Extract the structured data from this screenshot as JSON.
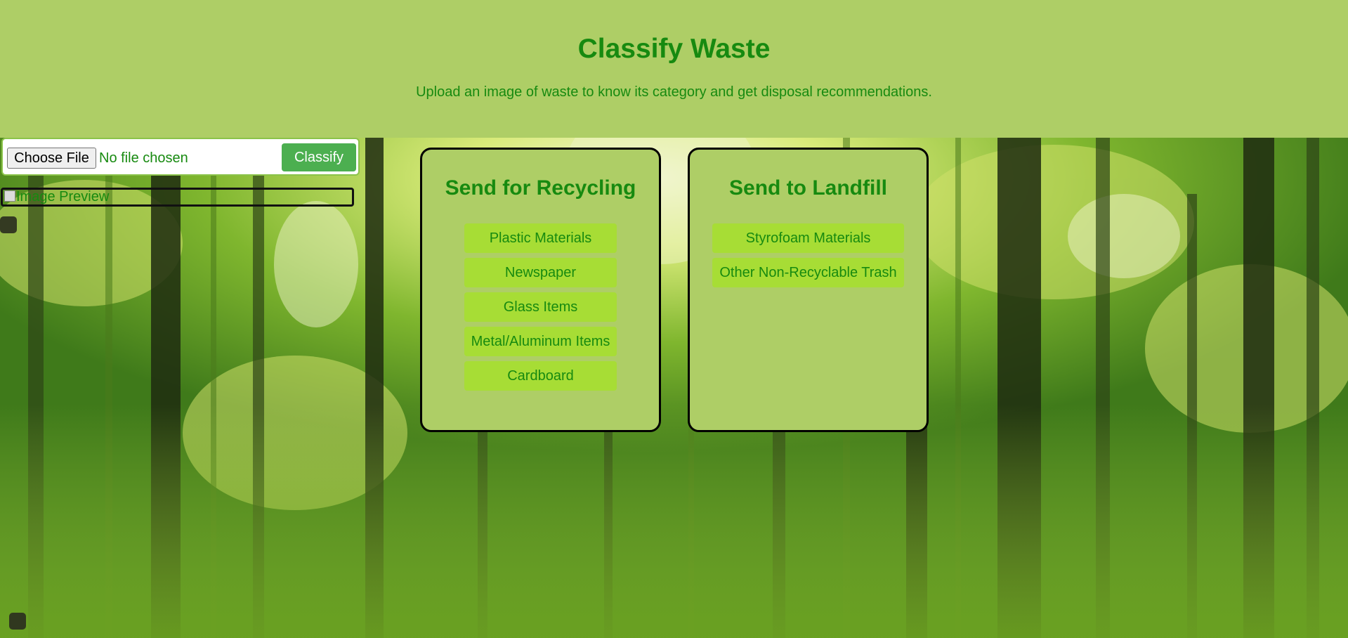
{
  "header": {
    "title": "Classify Waste",
    "subtitle": "Upload an image of waste to know its category and get disposal recommendations."
  },
  "upload": {
    "choose_label": "Choose File",
    "file_status": "No file chosen",
    "classify_label": "Classify"
  },
  "preview": {
    "alt_text": "Image Preview"
  },
  "recycling": {
    "title": "Send for Recycling",
    "items": [
      {
        "label": "Plastic Materials"
      },
      {
        "label": "Newspaper"
      },
      {
        "label": "Glass Items"
      },
      {
        "label": "Metal/Aluminum Items"
      },
      {
        "label": "Cardboard"
      }
    ]
  },
  "landfill": {
    "title": "Send to Landfill",
    "items": [
      {
        "label": "Styrofoam Materials"
      },
      {
        "label": "Other Non-Recyclable Trash"
      }
    ]
  },
  "colors": {
    "header_bg": "#aece66",
    "text_green": "#178a10",
    "button_green": "#4caf50",
    "item_bg": "#a7dd35"
  }
}
